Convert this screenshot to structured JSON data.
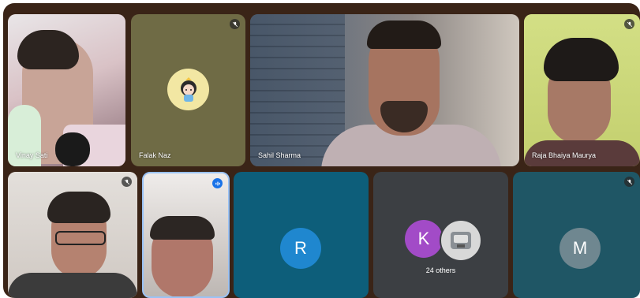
{
  "call": {
    "participants": [
      {
        "name": "Vinay Sati",
        "muted": false
      },
      {
        "name": "Falak Naz",
        "muted": true
      },
      {
        "name": "Sahil Sharma",
        "muted": false
      },
      {
        "name": "Raja Bhaiya Maurya",
        "muted": true
      },
      {
        "name": "",
        "muted": true
      },
      {
        "name": "",
        "speaking": true
      },
      {
        "initial": "R",
        "name": ""
      },
      {
        "initial": "K",
        "others_label": "24 others"
      },
      {
        "initial": "M"
      }
    ]
  },
  "colors": {
    "frame_bg": "#3a2417",
    "avatar_r": "#1f87cf",
    "avatar_k": "#a24bc7",
    "avatar_m": "#6f8790",
    "speaking_border": "#9ac2f5"
  }
}
